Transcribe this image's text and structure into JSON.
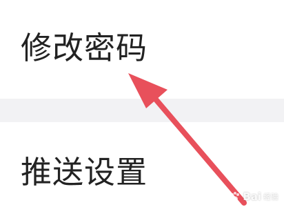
{
  "settings": {
    "items": [
      {
        "label": "修改密码"
      },
      {
        "label": "推送设置"
      }
    ]
  },
  "annotation": {
    "arrow_color": "#e8505b",
    "target": "修改密码"
  },
  "watermark": {
    "brand": "Bai",
    "brand_suffix": "经验"
  },
  "colors": {
    "background": "#ffffff",
    "divider": "#f2f2f4",
    "text": "#222222"
  }
}
